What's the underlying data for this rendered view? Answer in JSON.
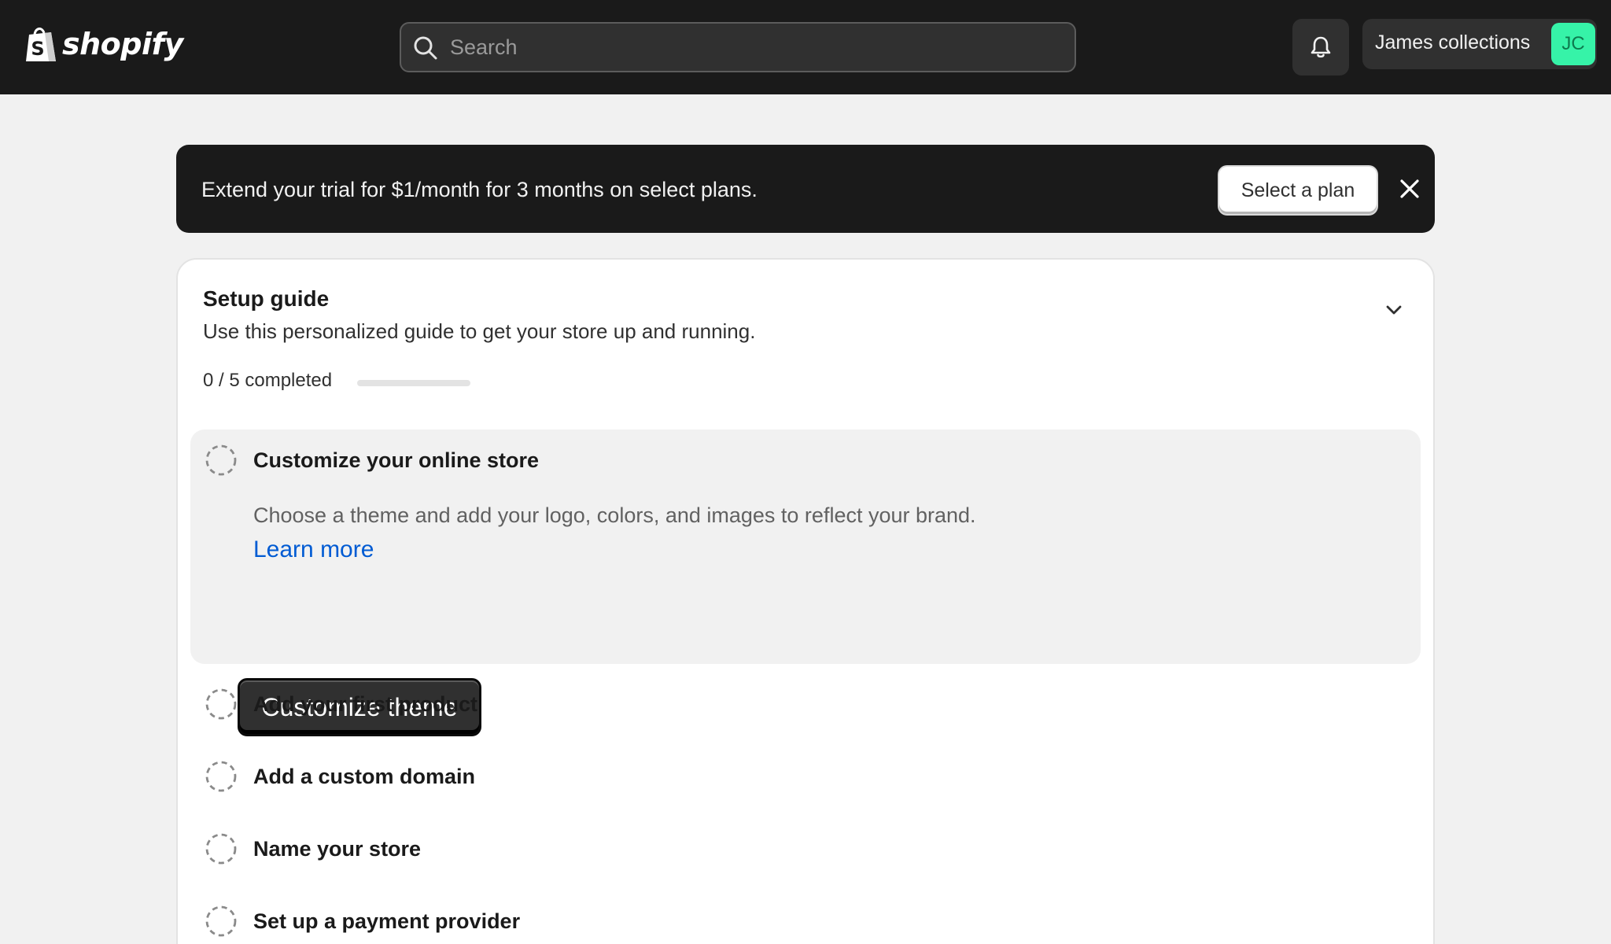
{
  "topbar": {
    "brand": "shopify",
    "search": {
      "placeholder": "Search",
      "value": ""
    },
    "account": {
      "name": "James collections",
      "initials": "JC",
      "avatar_color": "#36f3a8"
    }
  },
  "banner": {
    "message": "Extend your trial for $1/month for 3 months on select plans.",
    "button_label": "Select a plan"
  },
  "setup_guide": {
    "title": "Setup guide",
    "subtitle": "Use this personalized guide to get your store up and running.",
    "progress": {
      "text": "0 / 5 completed",
      "completed": 0,
      "total": 5
    },
    "active_task": {
      "title": "Customize your online store",
      "description": "Choose a theme and add your logo, colors, and images to reflect your brand.",
      "link_label": "Learn more",
      "button_label": "Customize theme"
    },
    "tasks": [
      {
        "title": "Add your first product"
      },
      {
        "title": "Add a custom domain"
      },
      {
        "title": "Name your store"
      },
      {
        "title": "Set up a payment provider"
      }
    ]
  }
}
